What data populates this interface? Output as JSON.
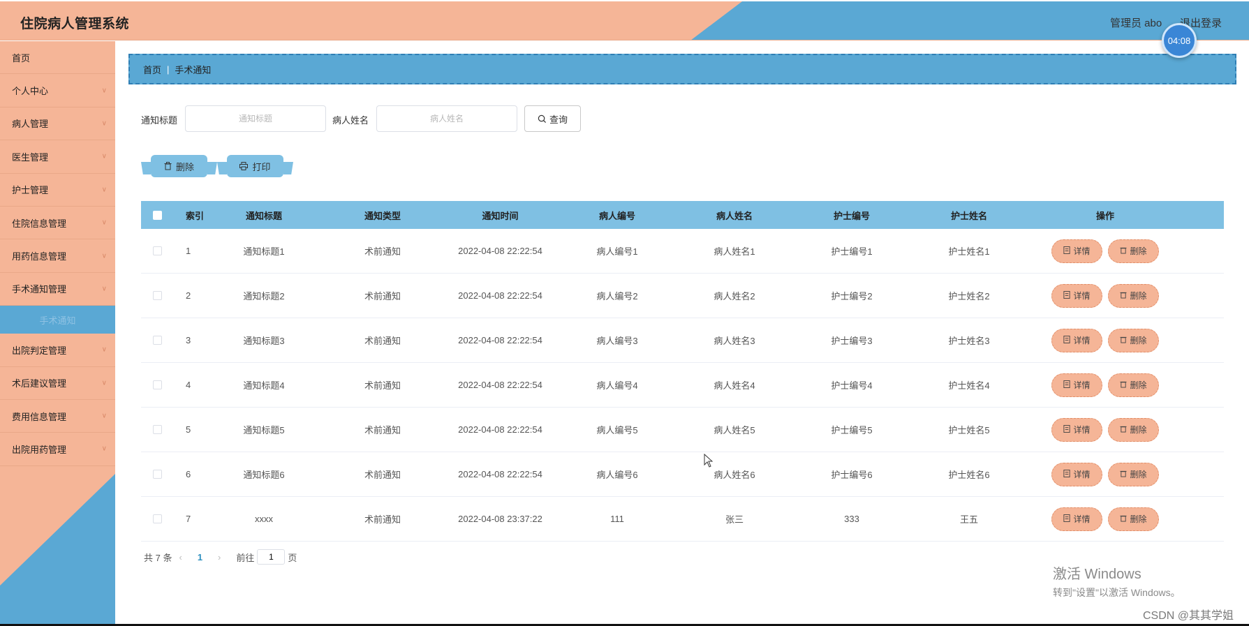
{
  "app": {
    "title": "住院病人管理系统",
    "admin": "管理员 abo",
    "logout": "退出登录",
    "timer": "04:08"
  },
  "colors": {
    "peach": "#f5b597",
    "blue": "#5aa8d4",
    "header_blue": "#7fc0e3"
  },
  "sidebar": {
    "items": [
      {
        "label": "首页",
        "icon": "none"
      },
      {
        "label": "个人中心",
        "icon": "chevron-down-icon"
      },
      {
        "label": "病人管理",
        "icon": "chevron-down-icon"
      },
      {
        "label": "医生管理",
        "icon": "chevron-down-icon"
      },
      {
        "label": "护士管理",
        "icon": "chevron-down-icon"
      },
      {
        "label": "住院信息管理",
        "icon": "chevron-down-icon"
      },
      {
        "label": "用药信息管理",
        "icon": "chevron-down-icon"
      },
      {
        "label": "手术通知管理",
        "icon": "chevron-down-icon"
      },
      {
        "label": "出院判定管理",
        "icon": "chevron-down-icon"
      },
      {
        "label": "术后建议管理",
        "icon": "chevron-down-icon"
      },
      {
        "label": "费用信息管理",
        "icon": "chevron-down-icon"
      },
      {
        "label": "出院用药管理",
        "icon": "chevron-down-icon"
      }
    ],
    "active_sub": "手术通知"
  },
  "breadcrumb": {
    "home": "首页",
    "separator": "|",
    "current": "手术通知"
  },
  "search": {
    "title_label": "通知标题",
    "title_placeholder": "通知标题",
    "name_label": "病人姓名",
    "name_placeholder": "病人姓名",
    "query_label": "查询"
  },
  "actions": {
    "delete_label": "删除",
    "print_label": "打印"
  },
  "table": {
    "headers": {
      "index": "索引",
      "title": "通知标题",
      "type": "通知类型",
      "time": "通知时间",
      "patient_no": "病人编号",
      "patient_name": "病人姓名",
      "nurse_no": "护士编号",
      "nurse_name": "护士姓名",
      "ops": "操作"
    },
    "detail_label": "详情",
    "delete_label": "删除",
    "rows": [
      {
        "index": "1",
        "title": "通知标题1",
        "type": "术前通知",
        "time": "2022-04-08 22:22:54",
        "patient_no": "病人编号1",
        "patient_name": "病人姓名1",
        "nurse_no": "护士编号1",
        "nurse_name": "护士姓名1"
      },
      {
        "index": "2",
        "title": "通知标题2",
        "type": "术前通知",
        "time": "2022-04-08 22:22:54",
        "patient_no": "病人编号2",
        "patient_name": "病人姓名2",
        "nurse_no": "护士编号2",
        "nurse_name": "护士姓名2"
      },
      {
        "index": "3",
        "title": "通知标题3",
        "type": "术前通知",
        "time": "2022-04-08 22:22:54",
        "patient_no": "病人编号3",
        "patient_name": "病人姓名3",
        "nurse_no": "护士编号3",
        "nurse_name": "护士姓名3"
      },
      {
        "index": "4",
        "title": "通知标题4",
        "type": "术前通知",
        "time": "2022-04-08 22:22:54",
        "patient_no": "病人编号4",
        "patient_name": "病人姓名4",
        "nurse_no": "护士编号4",
        "nurse_name": "护士姓名4"
      },
      {
        "index": "5",
        "title": "通知标题5",
        "type": "术前通知",
        "time": "2022-04-08 22:22:54",
        "patient_no": "病人编号5",
        "patient_name": "病人姓名5",
        "nurse_no": "护士编号5",
        "nurse_name": "护士姓名5"
      },
      {
        "index": "6",
        "title": "通知标题6",
        "type": "术前通知",
        "time": "2022-04-08 22:22:54",
        "patient_no": "病人编号6",
        "patient_name": "病人姓名6",
        "nurse_no": "护士编号6",
        "nurse_name": "护士姓名6"
      },
      {
        "index": "7",
        "title": "xxxx",
        "type": "术前通知",
        "time": "2022-04-08 23:37:22",
        "patient_no": "111",
        "patient_name": "张三",
        "nurse_no": "333",
        "nurse_name": "王五"
      }
    ]
  },
  "pagination": {
    "total": "共 7 条",
    "current": "1",
    "goto": "前往",
    "page_value": "1",
    "page_unit": "页"
  },
  "watermark": {
    "line1": "激活 Windows",
    "line2": "转到\"设置\"以激活 Windows。",
    "csdn": "CSDN @其其学姐"
  }
}
